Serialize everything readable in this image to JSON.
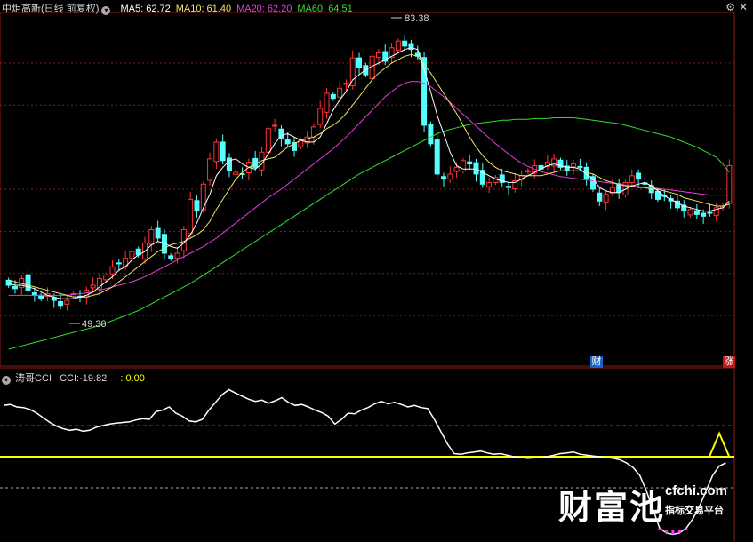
{
  "header": {
    "title": "中炬高新(日线 前复权)",
    "ma": [
      {
        "label": "MA5:",
        "value": "62.72",
        "color": "#ffffff"
      },
      {
        "label": "MA10:",
        "value": "61.40",
        "color": "#f0e26a"
      },
      {
        "label": "MA20:",
        "value": "62.20",
        "color": "#e23de0"
      },
      {
        "label": "MA60:",
        "value": "64.51",
        "color": "#33dd33"
      }
    ]
  },
  "indicator": {
    "title": "涛哥CCI",
    "cci_label": "CCI:",
    "cci_value": "-19.82",
    "second_label": ":",
    "second_value": "0.00"
  },
  "markers": {
    "finance": "财",
    "up": "涨"
  },
  "watermark": {
    "big": "财富池",
    "site": "cfchi.com",
    "sub": "指标交易平台"
  },
  "colors": {
    "up": "#ff3333",
    "down": "#54ffff",
    "ma5": "#ffffff",
    "ma10": "#f0e26a",
    "ma20": "#e23de0",
    "ma60": "#33dd33",
    "cci": "#ffffff",
    "zero": "#ffff00",
    "upper": "#ff2020",
    "lower": "#aaaaaa",
    "grid": "#8b1a1a",
    "panelBorder": "#8b1a1a"
  },
  "icons": {
    "menu": "gear-icon",
    "close": "close-icon"
  },
  "chart_data": [
    {
      "type": "candlestick",
      "title": "中炬高新(日线 前复权)",
      "ylim": [
        44,
        86
      ],
      "high_label": "83.38",
      "low_label": "49.30",
      "closes": [
        53.6,
        53.2,
        54.4,
        53.0,
        52.4,
        52.0,
        52.6,
        51.8,
        51.2,
        51.8,
        52.6,
        52.2,
        53.0,
        53.6,
        54.4,
        54.8,
        55.8,
        56.2,
        56.8,
        57.6,
        57.2,
        58.6,
        60.2,
        59.2,
        57.4,
        56.8,
        57.4,
        60.2,
        63.8,
        62.4,
        65.6,
        68.6,
        70.6,
        68.4,
        67.2,
        67.0,
        66.8,
        68.2,
        67.6,
        69.4,
        72.2,
        72.6,
        71.0,
        70.4,
        69.6,
        70.8,
        71.2,
        72.4,
        74.6,
        76.4,
        75.8,
        77.0,
        77.6,
        80.6,
        79.4,
        78.6,
        80.8,
        81.2,
        80.2,
        81.8,
        82.6,
        82.0,
        81.6,
        80.8,
        72.6,
        70.4,
        66.8,
        66.2,
        66.8,
        67.6,
        68.4,
        68.0,
        66.8,
        65.6,
        65.8,
        66.4,
        65.8,
        65.2,
        66.0,
        66.6,
        67.2,
        67.8,
        67.4,
        68.2,
        68.6,
        67.6,
        67.2,
        68.0,
        67.6,
        66.2,
        65.0,
        63.6,
        64.4,
        65.2,
        64.6,
        65.8,
        66.6,
        66.2,
        65.6,
        64.6,
        63.8,
        64.2,
        63.6,
        62.8,
        62.4,
        62.6,
        62.0,
        61.8,
        62.2,
        62.8,
        63.0,
        67.8
      ],
      "ma5": [
        53.8,
        53.6,
        53.6,
        53.4,
        53.2,
        52.8,
        52.4,
        52.2,
        52.0,
        52.0,
        52.0,
        52.2,
        52.4,
        52.8,
        53.4,
        54.0,
        54.6,
        55.4,
        55.8,
        56.6,
        57.2,
        57.6,
        58.4,
        58.8,
        58.6,
        58.2,
        58.0,
        58.6,
        59.6,
        61.0,
        62.8,
        64.4,
        66.6,
        67.6,
        68.4,
        68.6,
        68.0,
        67.6,
        67.4,
        68.0,
        69.2,
        70.4,
        71.4,
        71.6,
        71.2,
        70.8,
        70.6,
        70.6,
        71.2,
        72.8,
        74.4,
        75.6,
        76.6,
        78.0,
        78.6,
        79.2,
        79.6,
        80.0,
        80.4,
        80.8,
        81.2,
        81.6,
        81.8,
        81.6,
        79.2,
        76.6,
        73.8,
        71.6,
        69.4,
        67.8,
        67.4,
        67.4,
        67.4,
        67.0,
        66.6,
        66.2,
        66.0,
        65.8,
        65.8,
        66.2,
        66.6,
        67.0,
        67.4,
        67.8,
        68.0,
        67.8,
        67.6,
        67.6,
        67.4,
        66.8,
        66.2,
        65.2,
        64.8,
        64.6,
        64.6,
        65.0,
        65.4,
        65.6,
        65.8,
        65.4,
        64.8,
        64.2,
        63.8,
        63.4,
        63.0,
        62.8,
        62.6,
        62.4,
        62.4,
        62.6,
        62.8,
        63.6
      ],
      "ma10": [
        54.2,
        54.0,
        53.8,
        53.6,
        53.4,
        53.2,
        53.0,
        52.8,
        52.6,
        52.4,
        52.2,
        52.2,
        52.2,
        52.4,
        52.6,
        53.0,
        53.4,
        54.0,
        54.6,
        55.2,
        55.8,
        56.4,
        57.0,
        57.6,
        58.0,
        58.4,
        58.6,
        58.8,
        59.2,
        59.6,
        60.2,
        61.2,
        62.6,
        63.8,
        65.0,
        66.2,
        67.0,
        67.6,
        68.0,
        68.4,
        68.6,
        68.8,
        69.4,
        70.0,
        70.4,
        70.8,
        71.0,
        71.2,
        71.6,
        72.2,
        72.6,
        73.2,
        74.0,
        75.0,
        76.0,
        77.0,
        78.0,
        78.8,
        79.4,
        80.0,
        80.4,
        80.8,
        81.0,
        80.8,
        79.8,
        78.8,
        77.6,
        76.4,
        75.2,
        74.0,
        72.6,
        71.2,
        70.0,
        69.0,
        68.2,
        67.6,
        67.2,
        67.0,
        66.8,
        66.6,
        66.6,
        66.6,
        66.6,
        66.8,
        67.0,
        67.2,
        67.2,
        67.2,
        67.2,
        67.0,
        66.8,
        66.4,
        66.0,
        65.8,
        65.6,
        65.4,
        65.4,
        65.2,
        65.2,
        65.0,
        65.0,
        64.8,
        64.6,
        64.4,
        64.0,
        63.8,
        63.6,
        63.4,
        63.2,
        63.0,
        63.0,
        63.2
      ],
      "ma20": [
        52.4,
        52.4,
        52.4,
        52.4,
        52.4,
        52.4,
        52.4,
        52.4,
        52.4,
        52.4,
        52.5,
        52.6,
        52.7,
        52.8,
        53.0,
        53.2,
        53.4,
        53.6,
        53.8,
        54.0,
        54.3,
        54.6,
        55.0,
        55.4,
        55.8,
        56.2,
        56.6,
        57.0,
        57.4,
        57.8,
        58.2,
        58.7,
        59.2,
        59.8,
        60.4,
        61.0,
        61.6,
        62.2,
        62.8,
        63.4,
        64.0,
        64.5,
        65.0,
        65.6,
        66.2,
        66.8,
        67.4,
        68.0,
        68.6,
        69.2,
        69.8,
        70.5,
        71.2,
        72.0,
        72.8,
        73.6,
        74.4,
        75.2,
        76.0,
        76.6,
        77.2,
        77.6,
        77.8,
        77.8,
        77.6,
        77.2,
        76.6,
        76.0,
        75.3,
        74.6,
        73.9,
        73.2,
        72.5,
        71.8,
        71.1,
        70.4,
        69.8,
        69.2,
        68.6,
        68.1,
        67.7,
        67.4,
        67.1,
        66.9,
        66.7,
        66.5,
        66.4,
        66.3,
        66.2,
        66.1,
        66.0,
        65.9,
        65.8,
        65.7,
        65.6,
        65.5,
        65.4,
        65.3,
        65.2,
        65.2,
        65.1,
        65.0,
        64.9,
        64.8,
        64.7,
        64.6,
        64.5,
        64.4,
        64.3,
        64.3,
        64.3,
        64.3
      ],
      "ma60": [
        46.0,
        46.2,
        46.4,
        46.6,
        46.8,
        47.0,
        47.2,
        47.4,
        47.6,
        47.8,
        48.0,
        48.2,
        48.4,
        48.6,
        48.8,
        49.1,
        49.4,
        49.7,
        50.0,
        50.3,
        50.6,
        51.0,
        51.4,
        51.8,
        52.2,
        52.6,
        53.0,
        53.4,
        53.8,
        54.3,
        54.8,
        55.3,
        55.8,
        56.3,
        56.8,
        57.3,
        57.8,
        58.3,
        58.8,
        59.3,
        59.8,
        60.3,
        60.8,
        61.3,
        61.8,
        62.3,
        62.8,
        63.3,
        63.8,
        64.3,
        64.8,
        65.3,
        65.8,
        66.3,
        66.8,
        67.2,
        67.6,
        68.0,
        68.4,
        68.8,
        69.2,
        69.6,
        70.0,
        70.4,
        70.8,
        71.2,
        71.6,
        71.9,
        72.1,
        72.3,
        72.5,
        72.7,
        72.8,
        72.9,
        73.0,
        73.1,
        73.2,
        73.2,
        73.3,
        73.3,
        73.3,
        73.4,
        73.4,
        73.4,
        73.5,
        73.5,
        73.5,
        73.5,
        73.4,
        73.3,
        73.2,
        73.1,
        73.0,
        72.9,
        72.8,
        72.6,
        72.4,
        72.2,
        72.0,
        71.8,
        71.6,
        71.4,
        71.2,
        70.9,
        70.6,
        70.3,
        70.0,
        69.6,
        69.2,
        68.8,
        68.0,
        67.0
      ]
    },
    {
      "type": "line",
      "title": "涛哥CCI",
      "ylim": [
        -260,
        240
      ],
      "levels": {
        "upper": 100,
        "zero": 0,
        "lower": -100
      },
      "values": [
        165,
        168,
        160,
        158,
        152,
        140,
        125,
        110,
        98,
        90,
        85,
        88,
        82,
        85,
        95,
        100,
        105,
        108,
        110,
        112,
        118,
        122,
        120,
        145,
        150,
        160,
        140,
        130,
        115,
        112,
        120,
        150,
        175,
        200,
        216,
        205,
        195,
        185,
        178,
        182,
        172,
        180,
        190,
        175,
        165,
        168,
        160,
        150,
        142,
        130,
        105,
        120,
        140,
        138,
        150,
        158,
        170,
        178,
        170,
        175,
        168,
        160,
        165,
        158,
        155,
        120,
        80,
        40,
        10,
        8,
        12,
        15,
        18,
        12,
        8,
        10,
        5,
        0,
        -2,
        -5,
        -4,
        -2,
        0,
        5,
        10,
        12,
        15,
        8,
        5,
        2,
        0,
        -3,
        -5,
        -10,
        -20,
        -35,
        -60,
        -110,
        -170,
        -230,
        -245,
        -250,
        -245,
        -230,
        -200,
        -160,
        -110,
        -60,
        -30,
        -19.82
      ],
      "spike": {
        "index": 108,
        "value": 75
      }
    }
  ]
}
